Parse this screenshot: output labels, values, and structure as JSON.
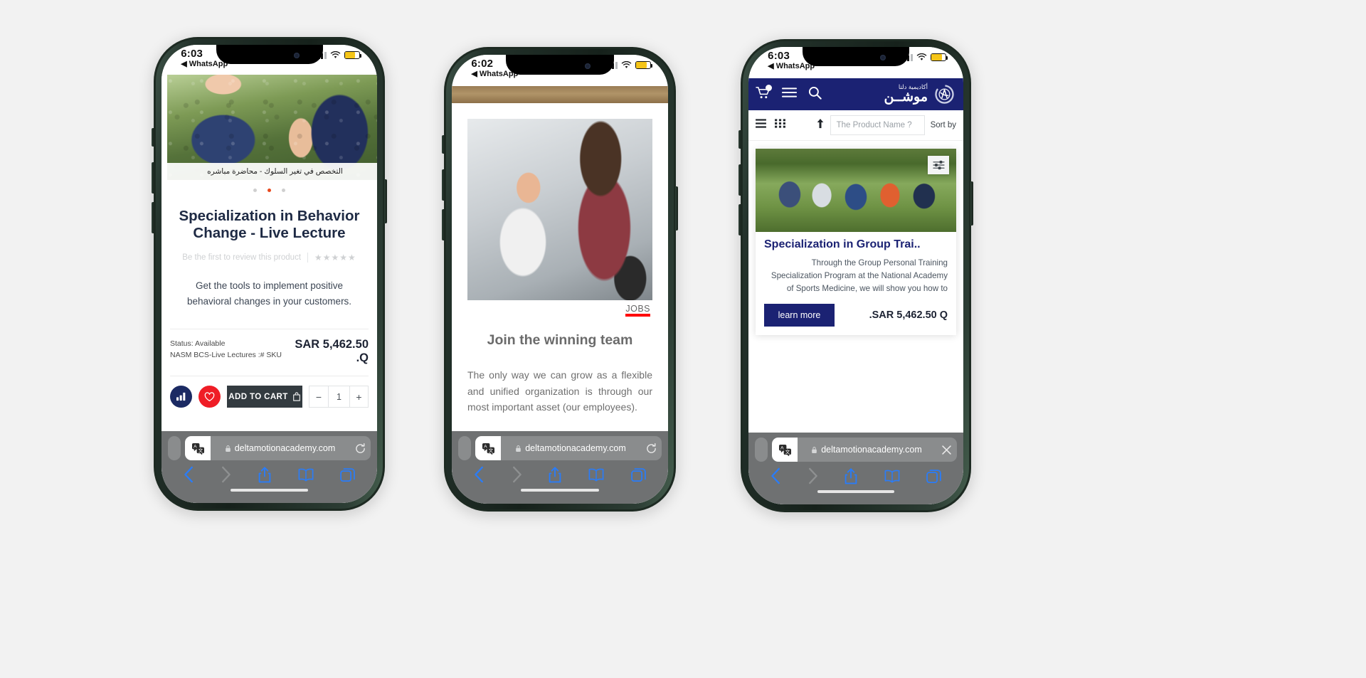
{
  "scene": {
    "background": "#f2f2f2"
  },
  "phones": [
    {
      "id": "phone-1",
      "status": {
        "time": "6:03",
        "back_app": "◀ WhatsApp"
      },
      "page": {
        "hero_caption": "التخصص في تغير السلوك - محاضرة مباشره",
        "carousel_dots": 3,
        "active_dot": 1,
        "product_title": "Specialization in Behavior Change - Live Lecture",
        "review_link": "Be the first to review this product",
        "stars": "★★★★★",
        "description": "Get the tools to implement positive behavioral changes in your customers.",
        "status_label": "Status: Available",
        "sku_label": "NASM BCS-Live Lectures :# SKU",
        "price": "SAR 5,462.50 .Q",
        "price_line1": "SAR 5,462.50",
        "price_line2": ".Q",
        "compare_icon": "bar-chart-icon",
        "wishlist_icon": "heart-icon",
        "add_to_cart_label": "ADD TO CART",
        "quantity_minus": "−",
        "quantity_value": "1",
        "quantity_plus": "+"
      },
      "safari": {
        "url": "deltamotionacademy.com",
        "translate_icon": "translate-icon",
        "lock_icon": "lock-icon",
        "right_action": "reload",
        "back_icon": "chevron-left-icon",
        "forward_icon": "chevron-right-icon",
        "share_icon": "share-icon",
        "bookmarks_icon": "book-icon",
        "tabs_icon": "tabs-icon"
      }
    },
    {
      "id": "phone-2",
      "status": {
        "time": "6:02",
        "back_app": "◀ WhatsApp"
      },
      "page": {
        "badge": "JOBS",
        "heading": "Join the winning team",
        "body": "The only way we can grow as a flexible and unified organization is through our most important asset (our employees)."
      },
      "safari": {
        "url": "deltamotionacademy.com",
        "translate_icon": "translate-icon",
        "lock_icon": "lock-icon",
        "right_action": "reload",
        "back_icon": "chevron-left-icon",
        "forward_icon": "chevron-right-icon",
        "share_icon": "share-icon",
        "bookmarks_icon": "book-icon",
        "tabs_icon": "tabs-icon"
      }
    },
    {
      "id": "phone-3",
      "status": {
        "time": "6:03",
        "back_app": "◀ WhatsApp"
      },
      "page": {
        "brand_main": "موشــن",
        "brand_sub": "أكاديمية دلتا",
        "cart_icon": "cart-icon",
        "menu_icon": "hamburger-icon",
        "search_icon": "search-icon",
        "list_view_icon": "list-view-icon",
        "grid_view_icon": "grid-view-icon",
        "sort_arrow_icon": "sort-ascending-icon",
        "search_placeholder": "The Product Name ?",
        "sort_by_label": "Sort by",
        "filter_icon": "filter-sliders-icon",
        "card_title": "Specialization in Group Trai..",
        "card_desc": "Through the Group Personal Training Specialization Program at the National Academy of Sports Medicine, we will show you how to",
        "learn_more_label": "learn more",
        "card_price": ".SAR 5,462.50 Q"
      },
      "safari": {
        "url": "deltamotionacademy.com",
        "translate_icon": "translate-icon",
        "lock_icon": "lock-icon",
        "right_action": "close",
        "back_icon": "chevron-left-icon",
        "forward_icon": "chevron-right-icon",
        "share_icon": "share-icon",
        "bookmarks_icon": "book-icon",
        "tabs_icon": "tabs-icon"
      }
    }
  ],
  "colors": {
    "brand_navy": "#1b2273",
    "accent_red": "#ef1d26",
    "jobs_red": "#ff0000",
    "dot_active": "#e8491d",
    "cart_dark": "#333b40",
    "safari_chrome": "#6f7172",
    "safari_blue": "#2a7cf7"
  }
}
